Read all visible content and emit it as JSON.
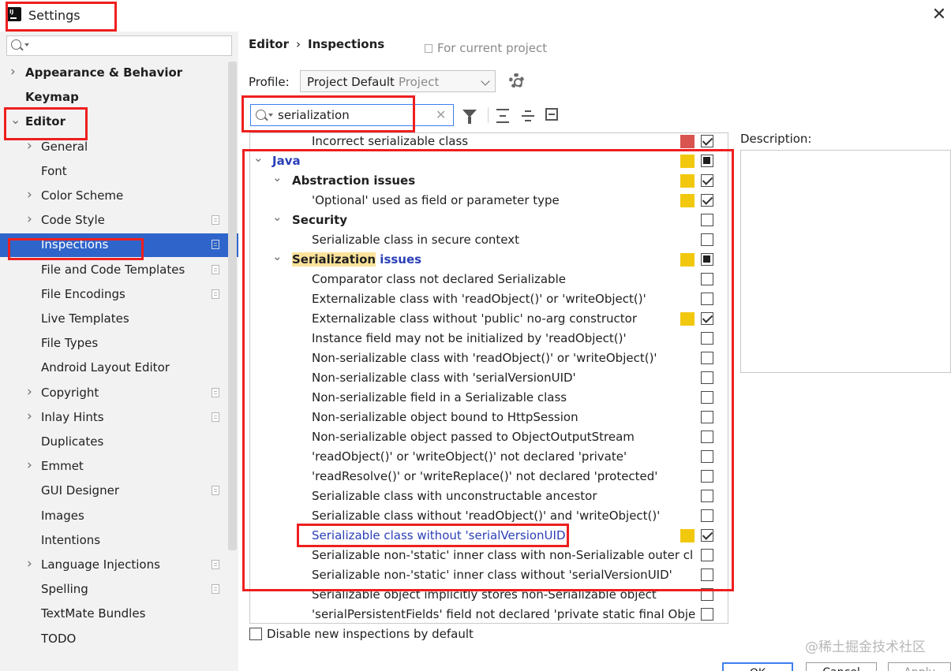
{
  "window": {
    "title": "Settings",
    "close_glyph": "✕"
  },
  "sidebar": {
    "search_placeholder": "",
    "items": [
      {
        "label": "Appearance & Behavior",
        "bold": true,
        "expanded": false,
        "indent": 0,
        "has_chevron": true
      },
      {
        "label": "Keymap",
        "bold": true,
        "indent": 0,
        "has_chevron": false
      },
      {
        "label": "Editor",
        "bold": true,
        "expanded": true,
        "indent": 0,
        "has_chevron": true
      },
      {
        "label": "General",
        "indent": 1,
        "has_chevron": true
      },
      {
        "label": "Font",
        "indent": 1,
        "has_chevron": false
      },
      {
        "label": "Color Scheme",
        "indent": 1,
        "has_chevron": true
      },
      {
        "label": "Code Style",
        "indent": 1,
        "has_chevron": true,
        "project_icon": true
      },
      {
        "label": "Inspections",
        "indent": 1,
        "has_chevron": false,
        "project_icon": true,
        "selected": true
      },
      {
        "label": "File and Code Templates",
        "indent": 1,
        "has_chevron": false,
        "project_icon": true
      },
      {
        "label": "File Encodings",
        "indent": 1,
        "has_chevron": false,
        "project_icon": true
      },
      {
        "label": "Live Templates",
        "indent": 1,
        "has_chevron": false
      },
      {
        "label": "File Types",
        "indent": 1,
        "has_chevron": false
      },
      {
        "label": "Android Layout Editor",
        "indent": 1,
        "has_chevron": false
      },
      {
        "label": "Copyright",
        "indent": 1,
        "has_chevron": true,
        "project_icon": true
      },
      {
        "label": "Inlay Hints",
        "indent": 1,
        "has_chevron": true,
        "project_icon": true
      },
      {
        "label": "Duplicates",
        "indent": 1,
        "has_chevron": false
      },
      {
        "label": "Emmet",
        "indent": 1,
        "has_chevron": true
      },
      {
        "label": "GUI Designer",
        "indent": 1,
        "has_chevron": false,
        "project_icon": true
      },
      {
        "label": "Images",
        "indent": 1,
        "has_chevron": false
      },
      {
        "label": "Intentions",
        "indent": 1,
        "has_chevron": false
      },
      {
        "label": "Language Injections",
        "indent": 1,
        "has_chevron": true,
        "project_icon": true
      },
      {
        "label": "Spelling",
        "indent": 1,
        "has_chevron": false,
        "project_icon": true
      },
      {
        "label": "TextMate Bundles",
        "indent": 1,
        "has_chevron": false
      },
      {
        "label": "TODO",
        "indent": 1,
        "has_chevron": false
      }
    ]
  },
  "breadcrumb": {
    "parent": "Editor",
    "separator": "›",
    "current": "Inspections"
  },
  "project_note": "For current project",
  "profile": {
    "label": "Profile:",
    "value": "Project Default",
    "scope": "Project"
  },
  "inspection_search": {
    "value": "serialization",
    "clear_glyph": "✕"
  },
  "tree": {
    "rows": [
      {
        "label": "Incorrect serializable class",
        "level": 2,
        "severity": "#d9534f",
        "checkbox": "checked"
      },
      {
        "label": "Java",
        "level": 0,
        "type": "java",
        "chevron": true,
        "severity": "#f2c80f",
        "checkbox": "partial"
      },
      {
        "label": "Abstraction issues",
        "level": 1,
        "bold": true,
        "chevron": true,
        "severity": "#f2c80f",
        "checkbox": "checked"
      },
      {
        "label": "'Optional' used as field or parameter type",
        "level": 2,
        "severity": "#f2c80f",
        "checkbox": "checked"
      },
      {
        "label": "Security",
        "level": 1,
        "bold": true,
        "chevron": true,
        "checkbox": "unchecked"
      },
      {
        "label": "Serializable class in secure context",
        "level": 2,
        "checkbox": "unchecked"
      },
      {
        "label": "Serialization",
        "label_suffix": " issues",
        "level": 1,
        "type": "serial",
        "chevron": true,
        "severity": "#f2c80f",
        "checkbox": "partial"
      },
      {
        "label": "Comparator class not declared Serializable",
        "level": 2,
        "checkbox": "unchecked"
      },
      {
        "label": "Externalizable class with 'readObject()' or 'writeObject()'",
        "level": 2,
        "checkbox": "unchecked"
      },
      {
        "label": "Externalizable class without 'public' no-arg constructor",
        "level": 2,
        "severity": "#f2c80f",
        "checkbox": "checked"
      },
      {
        "label": "Instance field may not be initialized by 'readObject()'",
        "level": 2,
        "checkbox": "unchecked"
      },
      {
        "label": "Non-serializable class with 'readObject()' or 'writeObject()'",
        "level": 2,
        "checkbox": "unchecked"
      },
      {
        "label": "Non-serializable class with 'serialVersionUID'",
        "level": 2,
        "checkbox": "unchecked"
      },
      {
        "label": "Non-serializable field in a Serializable class",
        "level": 2,
        "checkbox": "unchecked"
      },
      {
        "label": "Non-serializable object bound to HttpSession",
        "level": 2,
        "checkbox": "unchecked"
      },
      {
        "label": "Non-serializable object passed to ObjectOutputStream",
        "level": 2,
        "checkbox": "unchecked"
      },
      {
        "label": "'readObject()' or 'writeObject()' not declared 'private'",
        "level": 2,
        "checkbox": "unchecked"
      },
      {
        "label": "'readResolve()' or 'writeReplace()' not declared 'protected'",
        "level": 2,
        "checkbox": "unchecked"
      },
      {
        "label": "Serializable class with unconstructable ancestor",
        "level": 2,
        "checkbox": "unchecked"
      },
      {
        "label": "Serializable class without 'readObject()' and 'writeObject()'",
        "level": 2,
        "checkbox": "unchecked"
      },
      {
        "label": "Serializable class without 'serialVersionUID'",
        "level": 2,
        "type": "link",
        "severity": "#f2c80f",
        "checkbox": "checked"
      },
      {
        "label": "Serializable non-'static' inner class with non-Serializable outer cl",
        "level": 2,
        "checkbox": "unchecked"
      },
      {
        "label": "Serializable non-'static' inner class without 'serialVersionUID'",
        "level": 2,
        "checkbox": "unchecked"
      },
      {
        "label": "Serializable object implicitly stores non-Serializable object",
        "level": 2,
        "checkbox": "unchecked"
      },
      {
        "label": "'serialPersistentFields' field not declared 'private static final Obje",
        "level": 2,
        "checkbox": "unchecked"
      }
    ]
  },
  "description_label": "Description:",
  "disable_new_label": "Disable new inspections by default",
  "buttons": {
    "ok": "OK",
    "cancel": "Cancel",
    "apply": "Apply"
  },
  "watermark": "@稀土掘金技术社区",
  "colors": {
    "selection": "#2f65ca",
    "annotation": "#ee1f1f",
    "severity_warning": "#f2c80f",
    "severity_error": "#d9534f",
    "link": "#2a3fb8"
  },
  "icons": {
    "search": "search-icon",
    "filter": "filter-icon",
    "expand_all": "expand-all-icon",
    "collapse_all": "collapse-all-icon",
    "reset": "reset-icon",
    "gear": "gear-icon",
    "project": "project-scope-icon"
  }
}
